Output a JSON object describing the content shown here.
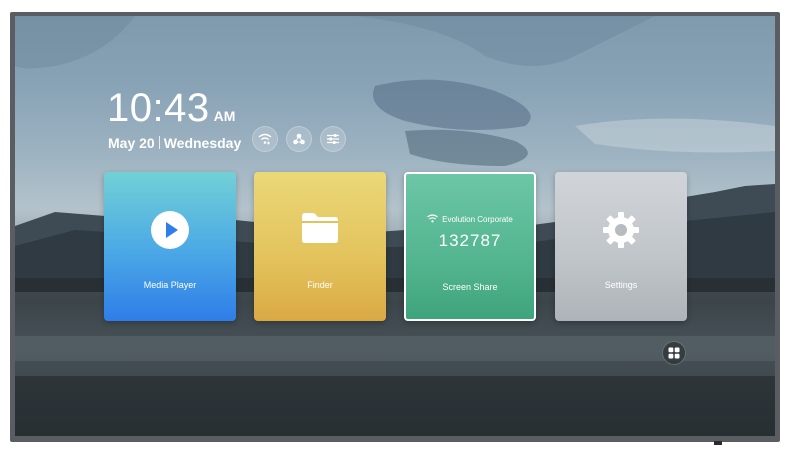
{
  "clock": {
    "time": "10:43",
    "ampm": "AM",
    "date": "May 20",
    "weekday": "Wednesday"
  },
  "status_icons": [
    {
      "name": "wifi-icon"
    },
    {
      "name": "network-share-icon"
    },
    {
      "name": "sliders-icon"
    }
  ],
  "tiles": {
    "media_player": {
      "label": "Media Player",
      "icon": "play-icon"
    },
    "finder": {
      "label": "Finder",
      "icon": "folder-icon"
    },
    "screen_share": {
      "label": "Screen Share",
      "network": "Evolution Corporate",
      "code": "132787"
    },
    "settings": {
      "label": "Settings",
      "icon": "gear-icon"
    }
  },
  "apps_button": {
    "icon": "apps-grid-icon"
  },
  "colors": {
    "media": "#3a92e6",
    "finder": "#e3c25b",
    "share": "#53b58f",
    "settings": "#bfc4c8"
  }
}
